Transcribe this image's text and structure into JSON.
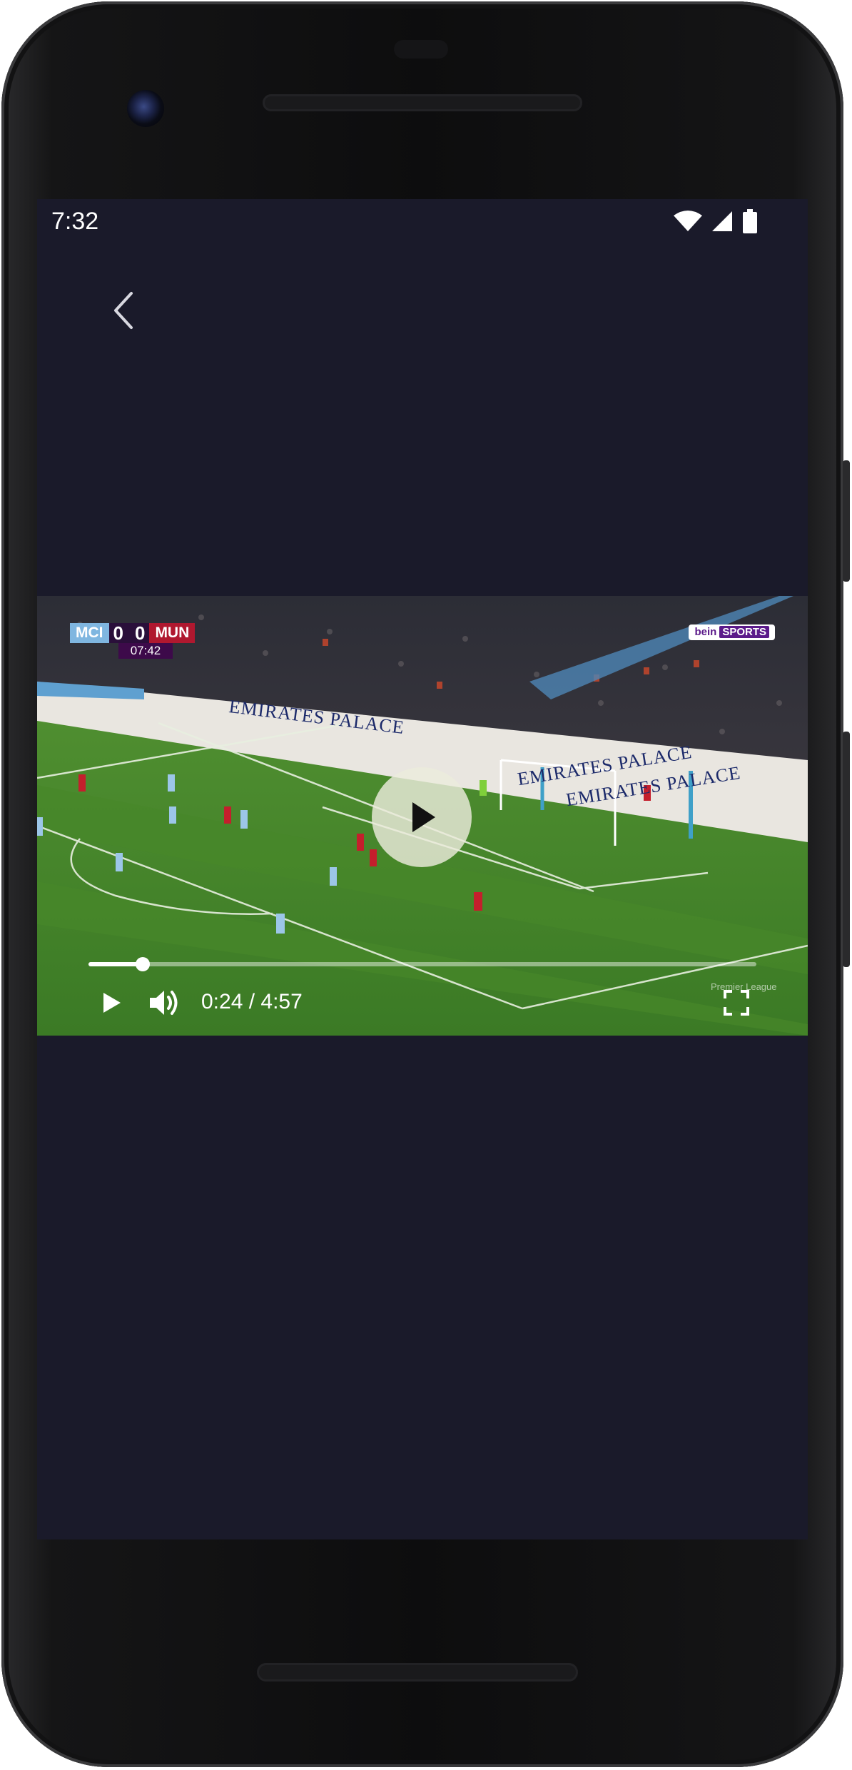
{
  "status_bar": {
    "time": "7:32"
  },
  "icons": {
    "back": "arrow-back-icon",
    "wifi": "wifi-icon",
    "signal": "cell-signal-icon",
    "battery": "battery-icon",
    "play_overlay": "play-icon",
    "play": "play-icon",
    "volume": "volume-icon",
    "fullscreen": "fullscreen-icon"
  },
  "video": {
    "scoreboard": {
      "home_team": "MCI",
      "home_score": "0",
      "away_score": "0",
      "away_team": "MUN",
      "match_clock": "07:42"
    },
    "broadcaster": {
      "name_a": "bein",
      "name_b": "SPORTS"
    },
    "ad_boards": [
      "EMIRATES PALACE",
      "EMIRATES PALACE",
      "EMIRATES PALACE"
    ],
    "watermark": [
      "Premier League"
    ],
    "player": {
      "time_display": "0:24 / 4:57",
      "progress_fraction": 0.081
    }
  },
  "colors": {
    "screen_background": "#1a1a2a",
    "pitch_green": "#3f7d2a",
    "home_color": "#7fb6e0",
    "away_color": "#b0182f",
    "control_white": "#ffffff"
  }
}
